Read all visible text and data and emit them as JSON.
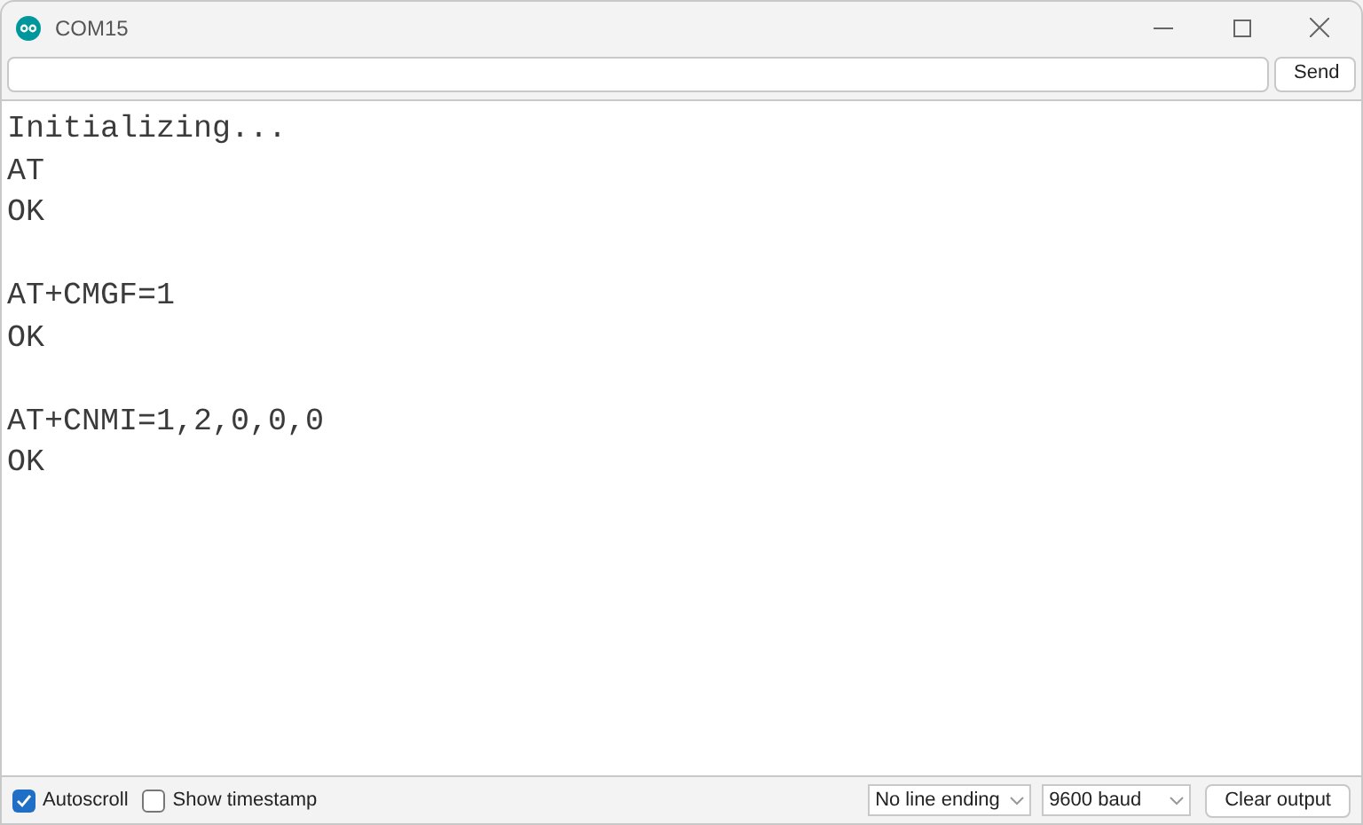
{
  "window": {
    "title": "COM15"
  },
  "input": {
    "button": "Send"
  },
  "output": [
    {
      "lines": [
        "Initializing...",
        "AT",
        "OK"
      ]
    },
    {
      "lines": [
        "AT+CMGF=1",
        "OK"
      ]
    },
    {
      "lines": [
        "AT+CNMI=1,2,0,0,0",
        "OK"
      ]
    }
  ],
  "footer": {
    "checkboxes": [
      {
        "label": "Autoscroll",
        "checked": true
      },
      {
        "label": "Show timestamp",
        "checked": false
      }
    ],
    "line_ending": "No line ending",
    "baud": "9600 baud",
    "clear_button": "Clear output"
  }
}
